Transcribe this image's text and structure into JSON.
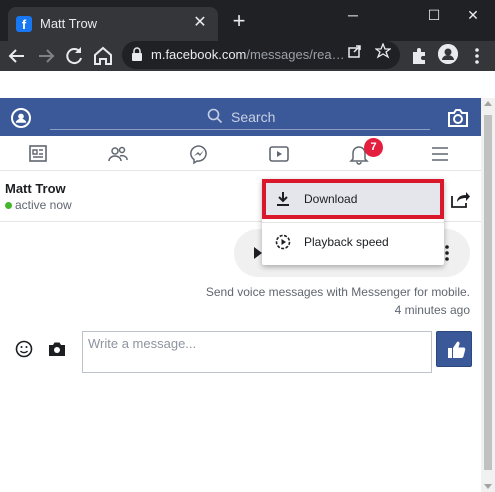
{
  "browser": {
    "tab_title": "Matt Trow",
    "favicon": "facebook-icon",
    "url_host": "m.facebook.com",
    "url_path": "/messages/rea…",
    "close_glyph": "✕",
    "new_tab_glyph": "+",
    "window_controls": {
      "minimize": "─",
      "maximize": "☐",
      "close": "✕"
    }
  },
  "header": {
    "search_label": "Search",
    "brand_color": "#3b5998"
  },
  "nav": {
    "items": [
      "news-feed-icon",
      "friends-icon",
      "messenger-icon",
      "watch-icon",
      "notifications-icon",
      "menu-icon"
    ],
    "notification_count": "7"
  },
  "conversation": {
    "contact_name": "Matt Trow",
    "status": "active now",
    "voice_note": "Send voice messages with Messenger for mobile.",
    "timestamp": "4 minutes ago"
  },
  "composer": {
    "placeholder": "Write a message..."
  },
  "context_menu": {
    "items": [
      {
        "label": "Download",
        "icon": "download-icon"
      },
      {
        "label": "Playback speed",
        "icon": "playback-speed-icon"
      }
    ],
    "highlight_color": "#d9182b"
  }
}
